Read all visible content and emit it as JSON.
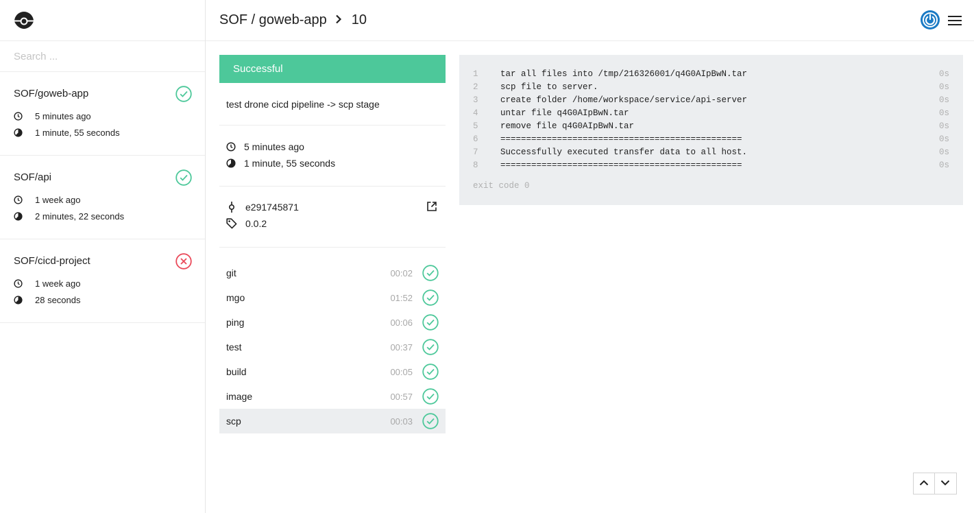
{
  "colors": {
    "success": "#4dc89a",
    "failure": "#ea4a5a",
    "power": "#1a7ac4"
  },
  "search": {
    "placeholder": "Search ..."
  },
  "repos": [
    {
      "name": "SOF/goweb-app",
      "status": "success",
      "created": "5 minutes ago",
      "duration": "1 minute, 55 seconds",
      "status_icon": "check-circle-icon"
    },
    {
      "name": "SOF/api",
      "status": "success",
      "created": "1 week ago",
      "duration": "2 minutes, 22 seconds",
      "status_icon": "check-circle-icon"
    },
    {
      "name": "SOF/cicd-project",
      "status": "failure",
      "created": "1 week ago",
      "duration": "28 seconds",
      "status_icon": "x-circle-icon"
    }
  ],
  "header": {
    "path": "SOF / goweb-app",
    "build_number": "10"
  },
  "build": {
    "status_label": "Successful",
    "message": "test drone cicd pipeline -> scp stage",
    "created": "5 minutes ago",
    "duration": "1 minute, 55 seconds",
    "commit": "e291745871",
    "tag": "0.0.2"
  },
  "steps": [
    {
      "name": "git",
      "time": "00:02",
      "status": "success"
    },
    {
      "name": "mgo",
      "time": "01:52",
      "status": "success"
    },
    {
      "name": "ping",
      "time": "00:06",
      "status": "success"
    },
    {
      "name": "test",
      "time": "00:37",
      "status": "success"
    },
    {
      "name": "build",
      "time": "00:05",
      "status": "success"
    },
    {
      "name": "image",
      "time": "00:57",
      "status": "success"
    },
    {
      "name": "scp",
      "time": "00:03",
      "status": "success",
      "selected": true
    }
  ],
  "log": {
    "lines": [
      {
        "num": "1",
        "text": "tar all files into /tmp/216326001/q4G0AIpBwN.tar",
        "time": "0s"
      },
      {
        "num": "2",
        "text": "scp file to server.",
        "time": "0s"
      },
      {
        "num": "3",
        "text": "create folder /home/workspace/service/api-server",
        "time": "0s"
      },
      {
        "num": "4",
        "text": "untar file q4G0AIpBwN.tar",
        "time": "0s"
      },
      {
        "num": "5",
        "text": "remove file q4G0AIpBwN.tar",
        "time": "0s"
      },
      {
        "num": "6",
        "text": "===============================================",
        "time": "0s"
      },
      {
        "num": "7",
        "text": "Successfully executed transfer data to all host.",
        "time": "0s"
      },
      {
        "num": "8",
        "text": "===============================================",
        "time": "0s"
      }
    ],
    "exit": "exit code 0"
  }
}
